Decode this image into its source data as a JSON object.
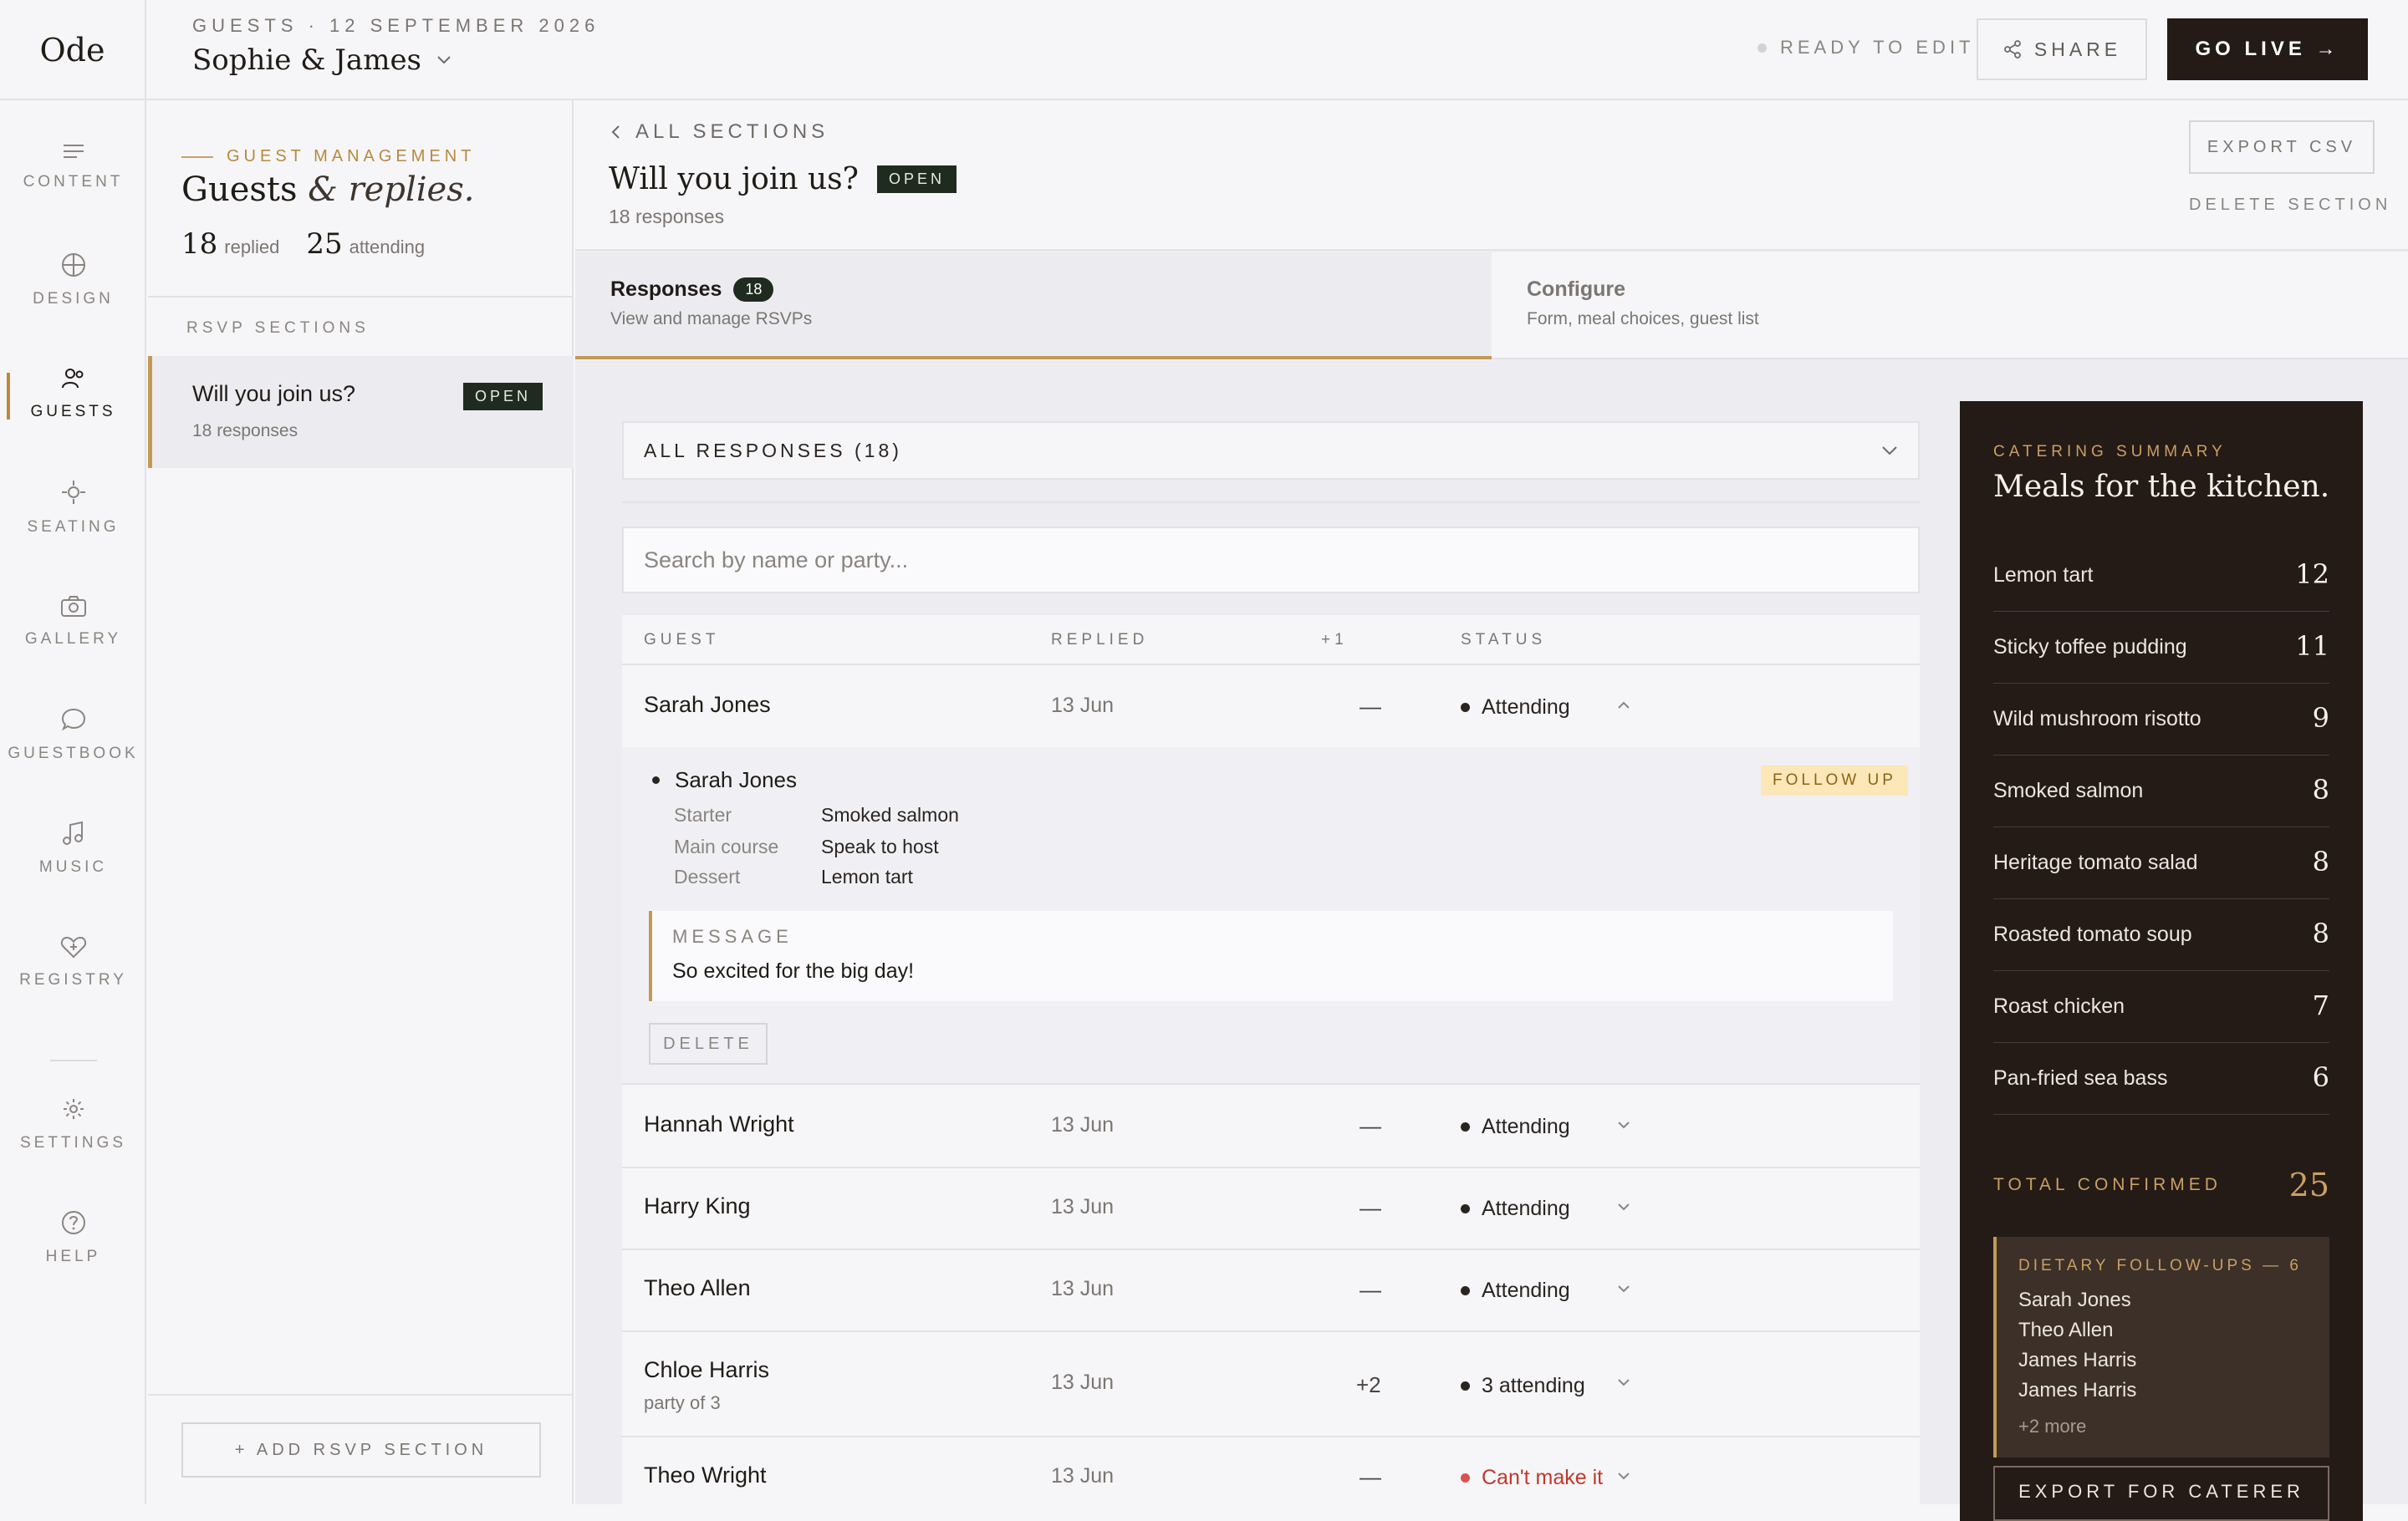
{
  "app": {
    "logo": "Ode"
  },
  "header": {
    "breadcrumb": "GUESTS · 12 SEPTEMBER 2026",
    "couple": "Sophie & James",
    "status": "READY TO EDIT",
    "share_label": "SHARE",
    "golive_label": "GO LIVE →"
  },
  "nav": {
    "items": [
      {
        "label": "CONTENT",
        "icon": "lines-icon"
      },
      {
        "label": "DESIGN",
        "icon": "globe-icon"
      },
      {
        "label": "GUESTS",
        "icon": "people-icon",
        "active": true
      },
      {
        "label": "SEATING",
        "icon": "seating-icon"
      },
      {
        "label": "GALLERY",
        "icon": "camera-icon"
      },
      {
        "label": "GUESTBOOK",
        "icon": "chat-icon"
      },
      {
        "label": "MUSIC",
        "icon": "music-icon"
      },
      {
        "label": "REGISTRY",
        "icon": "heart-icon"
      },
      {
        "label": "SETTINGS",
        "icon": "gear-icon"
      },
      {
        "label": "HELP",
        "icon": "help-icon"
      }
    ]
  },
  "sections_panel": {
    "eyebrow": "GUEST MANAGEMENT",
    "title_main": "Guests",
    "title_amp": "&",
    "title_italic": "replies.",
    "replied_count": "18",
    "replied_label": "replied",
    "attending_count": "25",
    "attending_label": "attending",
    "rsvp_header": "RSVP SECTIONS",
    "card_title": "Will you join us?",
    "card_badge": "OPEN",
    "card_sub": "18 responses",
    "add_label": "+ ADD RSVP SECTION"
  },
  "main": {
    "back_label": "ALL SECTIONS",
    "title": "Will you join us?",
    "badge": "OPEN",
    "subtitle": "18 responses",
    "export_csv": "EXPORT CSV",
    "delete_section": "DELETE SECTION",
    "tabs": [
      {
        "label": "Responses",
        "count": "18",
        "sub": "View and manage RSVPs"
      },
      {
        "label": "Configure",
        "sub": "Form, meal choices, guest list"
      }
    ],
    "filter_label": "ALL RESPONSES (18)",
    "search_placeholder": "Search by name or party...",
    "columns": [
      "GUEST",
      "REPLIED",
      "+1",
      "STATUS"
    ]
  },
  "responses": {
    "expanded": {
      "name": "Sarah Jones",
      "date": "13 Jun",
      "plus": "—",
      "status": "Attending",
      "guest_name": "Sarah Jones",
      "follow_up": "FOLLOW UP",
      "starter_label": "Starter",
      "starter": "Smoked salmon",
      "main_label": "Main course",
      "main": "Speak to host",
      "dessert_label": "Dessert",
      "dessert": "Lemon tart",
      "message_label": "MESSAGE",
      "message": "So excited for the big day!",
      "delete_label": "DELETE"
    },
    "rows": [
      {
        "name": "Hannah Wright",
        "date": "13 Jun",
        "plus": "—",
        "status": "Attending"
      },
      {
        "name": "Harry King",
        "date": "13 Jun",
        "plus": "—",
        "status": "Attending"
      },
      {
        "name": "Theo Allen",
        "date": "13 Jun",
        "plus": "—",
        "status": "Attending"
      },
      {
        "name": "Chloe Harris",
        "party": "party of 3",
        "date": "13 Jun",
        "plus": "+2",
        "status": "3 attending"
      },
      {
        "name": "Theo Wright",
        "date": "13 Jun",
        "plus": "—",
        "status": "Can't make it"
      }
    ]
  },
  "catering": {
    "eyebrow": "CATERING SUMMARY",
    "title": "Meals for the kitchen.",
    "items": [
      {
        "name": "Lemon tart",
        "count": "12"
      },
      {
        "name": "Sticky toffee pudding",
        "count": "11"
      },
      {
        "name": "Wild mushroom risotto",
        "count": "9"
      },
      {
        "name": "Smoked salmon",
        "count": "8"
      },
      {
        "name": "Heritage tomato salad",
        "count": "8"
      },
      {
        "name": "Roasted tomato soup",
        "count": "8"
      },
      {
        "name": "Roast chicken",
        "count": "7"
      },
      {
        "name": "Pan-fried sea bass",
        "count": "6"
      }
    ],
    "total_label": "TOTAL CONFIRMED",
    "total": "25",
    "dietary_header": "DIETARY FOLLOW-UPS — 6",
    "dietary": [
      "Sarah Jones",
      "Theo Allen",
      "James Harris",
      "James Harris"
    ],
    "dietary_more": "+2 more",
    "export_label": "EXPORT FOR CATERER"
  },
  "colors": {
    "accent": "#b8893e",
    "dark": "#241a16",
    "badge": "#1f2b1e",
    "danger": "#d9534f"
  }
}
